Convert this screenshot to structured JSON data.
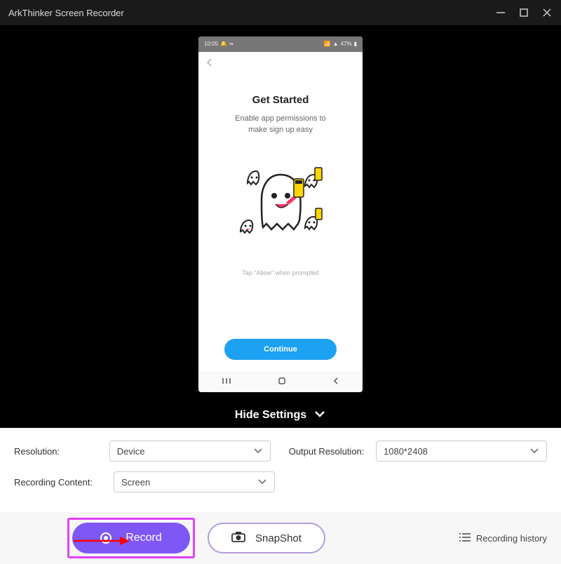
{
  "titlebar": {
    "title": "ArkThinker Screen Recorder"
  },
  "phone": {
    "status": {
      "time": "10:05",
      "battery": "47%"
    },
    "title": "Get Started",
    "subtitle_line1": "Enable app permissions to",
    "subtitle_line2": "make sign up easy",
    "hint": "Tap \"Allow\" when prompted",
    "continue_label": "Continue"
  },
  "settings": {
    "toggle_label": "Hide Settings",
    "resolution_label": "Resolution:",
    "resolution_value": "Device",
    "output_resolution_label": "Output Resolution:",
    "output_resolution_value": "1080*2408",
    "recording_content_label": "Recording Content:",
    "recording_content_value": "Screen"
  },
  "actions": {
    "record_label": "Record",
    "snapshot_label": "SnapShot",
    "history_label": "Recording history"
  }
}
